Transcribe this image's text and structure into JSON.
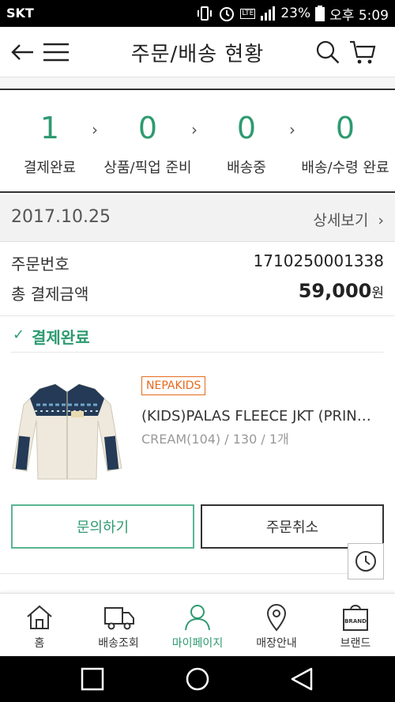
{
  "statusbar": {
    "carrier": "SKT",
    "battery": "23%",
    "time": "오후 5:09",
    "lte_label": "LTE"
  },
  "header": {
    "title": "주문/배송 현황"
  },
  "steps": [
    {
      "count": "1",
      "label": "결제완료"
    },
    {
      "count": "0",
      "label": "상품/픽업 준비"
    },
    {
      "count": "0",
      "label": "배송중"
    },
    {
      "count": "0",
      "label": "배송/수령 완료"
    }
  ],
  "step_arrow": "›",
  "order": {
    "date": "2017.10.25",
    "detail_label": "상세보기",
    "number_label": "주문번호",
    "number_value": "1710250001338",
    "total_label": "총 결제금액",
    "total_value": "59,000",
    "total_unit": "원",
    "status": "결제완료"
  },
  "product": {
    "brand": "NEPAKIDS",
    "name": "(KIDS)PALAS FLEECE JKT (PRIN…",
    "options": "CREAM(104) / 130 / 1개"
  },
  "buttons": {
    "inquiry": "문의하기",
    "cancel": "주문취소"
  },
  "tabs": [
    {
      "label": "홈",
      "icon": "home-icon"
    },
    {
      "label": "배송조회",
      "icon": "truck-icon"
    },
    {
      "label": "마이페이지",
      "icon": "person-icon"
    },
    {
      "label": "매장안내",
      "icon": "location-pin-icon"
    },
    {
      "label": "브랜드",
      "icon": "brand-bag-icon"
    }
  ],
  "brand_icon_text": "BRAND",
  "colors": {
    "accent": "#2e9a70",
    "brand_tag": "#e56a1e"
  }
}
